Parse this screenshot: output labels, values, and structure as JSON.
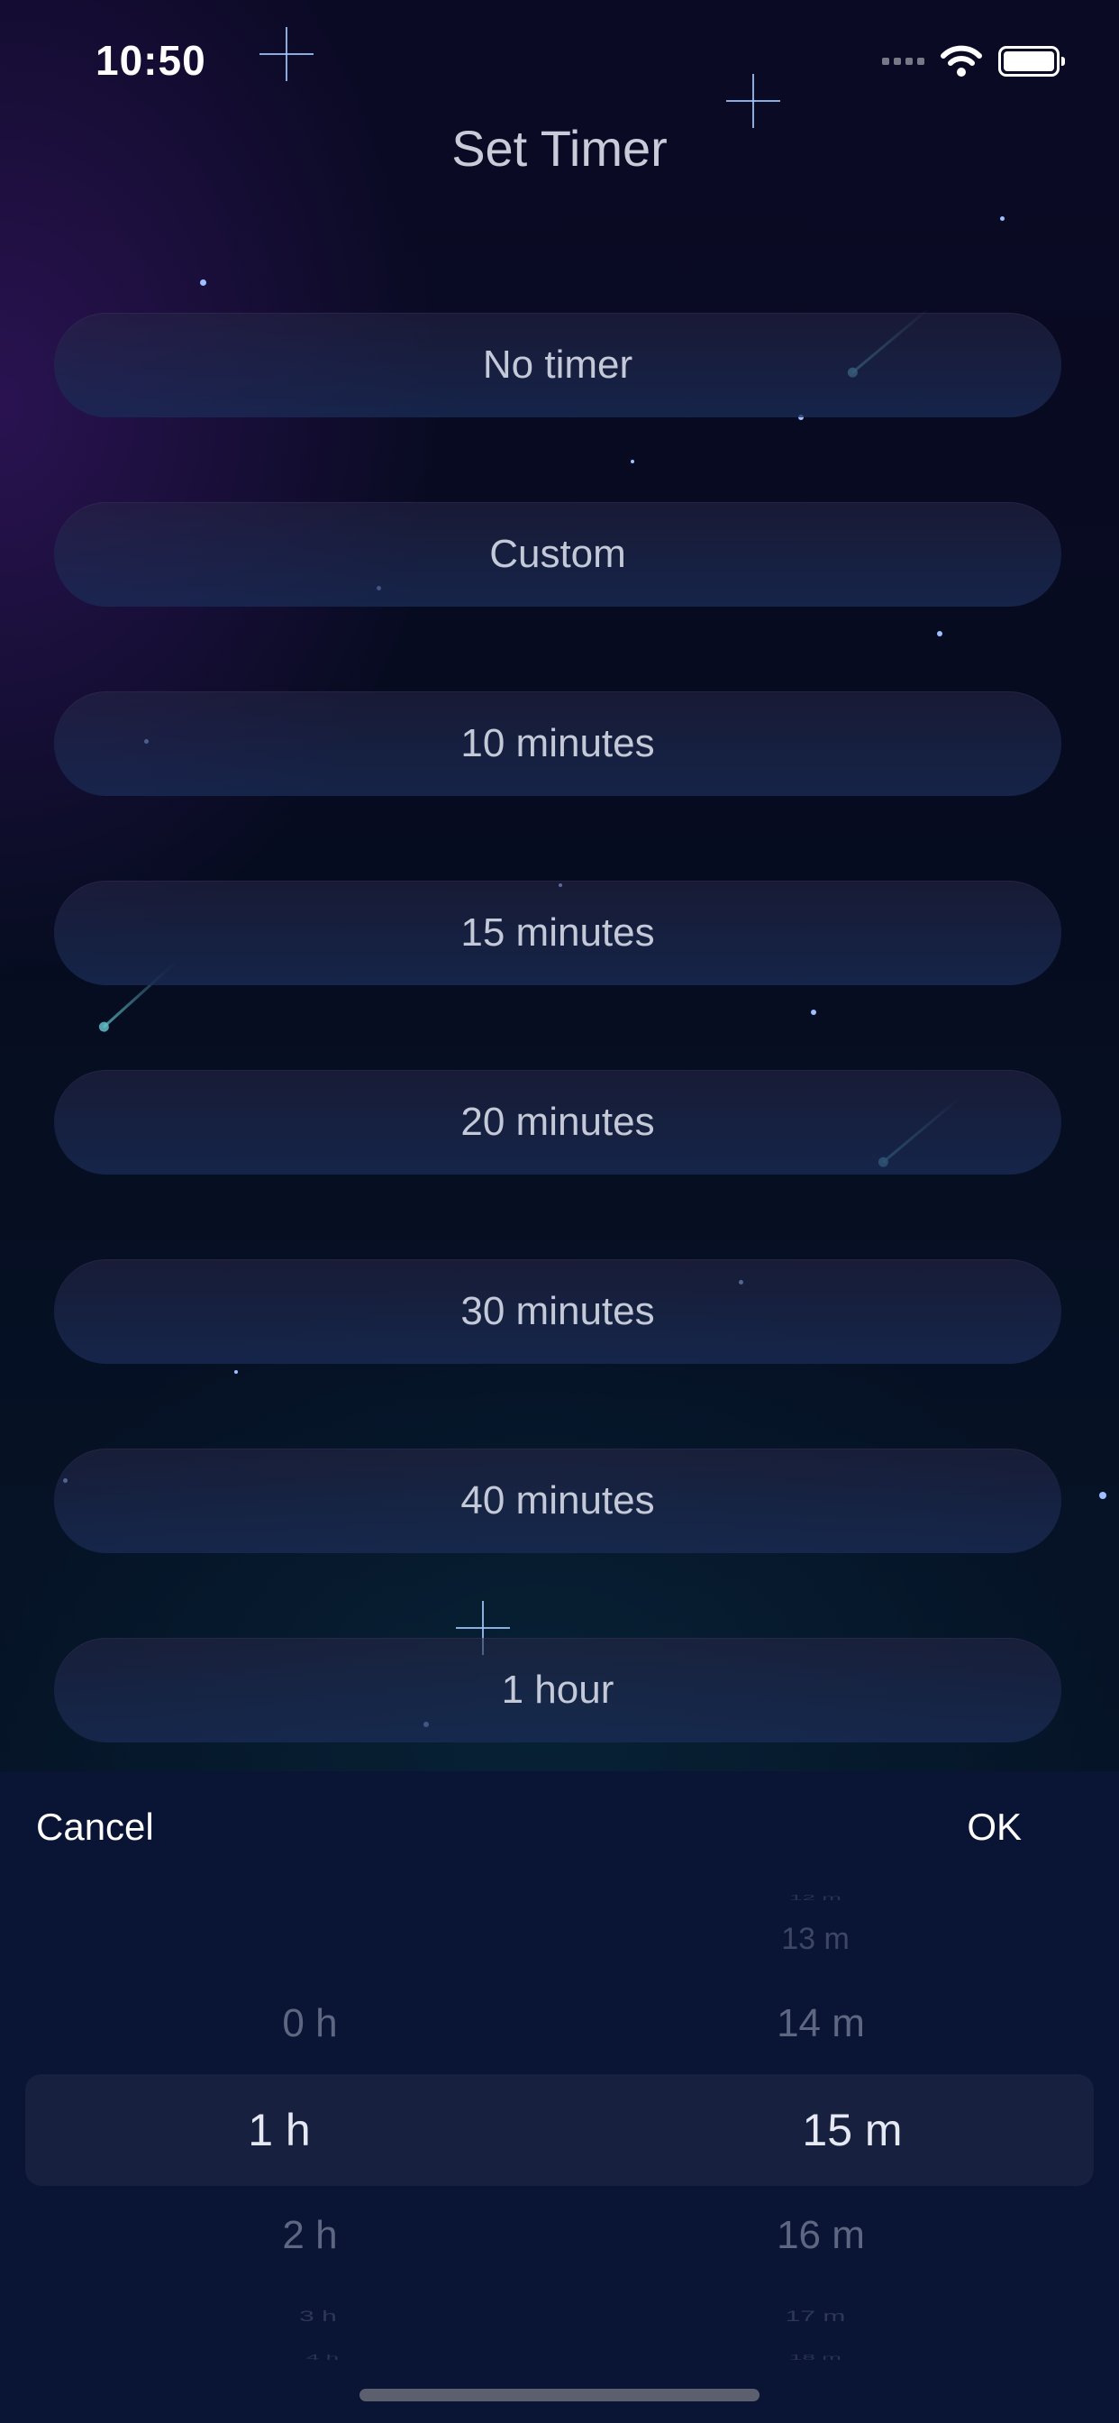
{
  "status_bar": {
    "time": "10:50"
  },
  "header": {
    "title": "Set Timer"
  },
  "timer_options": [
    "No timer",
    "Custom",
    "10 minutes",
    "15 minutes",
    "20 minutes",
    "30 minutes",
    "40 minutes",
    "1 hour"
  ],
  "picker": {
    "cancel_label": "Cancel",
    "ok_label": "OK",
    "hours": {
      "above": "0 h",
      "selected": "1 h",
      "below": "2 h",
      "below2": "3 h",
      "below3": "4 h"
    },
    "minutes": {
      "above3": "12 m",
      "above2": "13 m",
      "above": "14 m",
      "selected": "15 m",
      "below": "16 m",
      "below2": "17 m",
      "below3": "18 m"
    }
  },
  "colors": {
    "sheet_background": "#0a1535",
    "option_text": "#c4c9d8",
    "title_text": "#c9ccd8"
  }
}
